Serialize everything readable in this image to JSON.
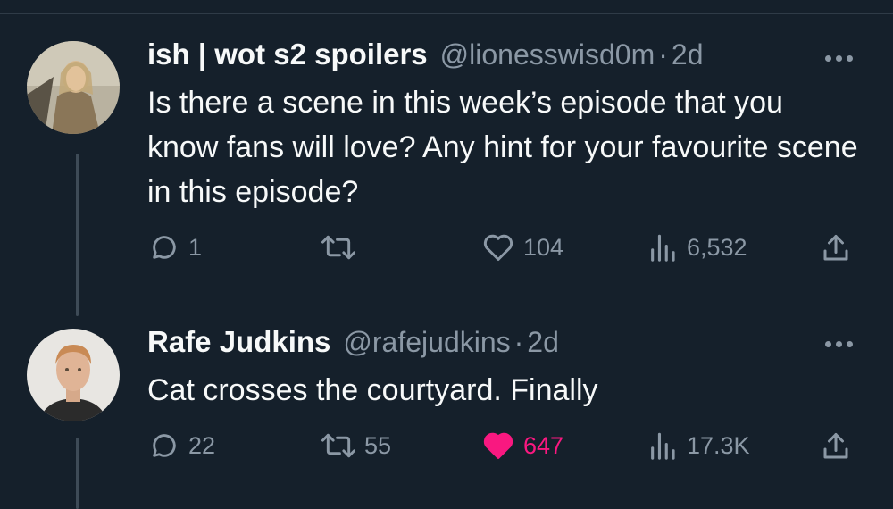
{
  "tweets": [
    {
      "name": "ish | wot s2 spoilers",
      "handle": "@lionesswisd0m",
      "separator": "·",
      "age": "2d",
      "text": "Is there a scene in this week’s episode that you know fans will love? Any hint for your favourite scene in this episode?",
      "replies": "1",
      "retweets": "",
      "likes": "104",
      "views": "6,532",
      "liked": false
    },
    {
      "name": "Rafe Judkins",
      "handle": "@rafejudkins",
      "separator": "·",
      "age": "2d",
      "text": "Cat crosses the courtyard.  Finally",
      "replies": "22",
      "retweets": "55",
      "likes": "647",
      "views": "17.3K",
      "liked": true
    }
  ],
  "icons": {
    "reply": "reply-icon",
    "retweet": "retweet-icon",
    "like": "heart-icon",
    "views": "views-icon",
    "share": "share-icon",
    "more": "more-icon"
  },
  "colors": {
    "background": "#15202b",
    "text": "#f7f9f9",
    "muted": "#8b98a5",
    "like": "#f91880"
  }
}
